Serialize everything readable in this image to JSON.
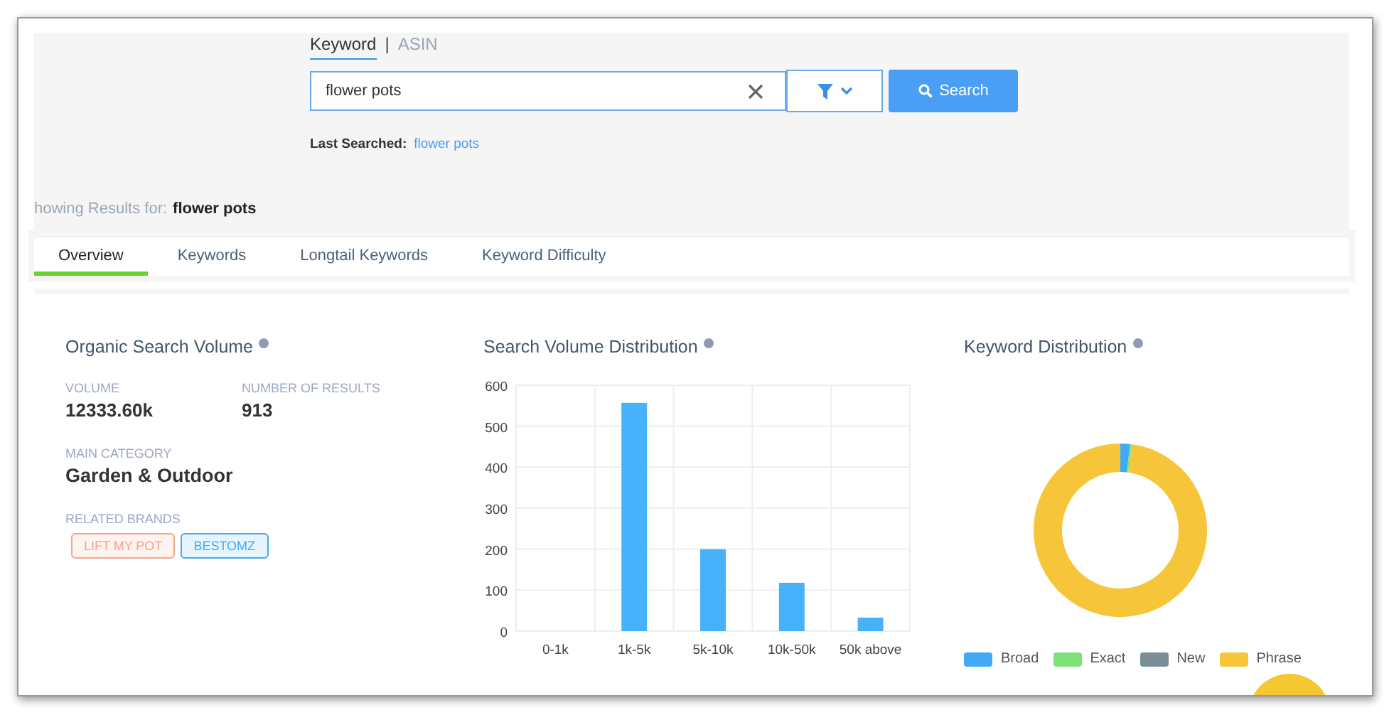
{
  "search_mode_separator": "|",
  "search_mode_tabs": [
    {
      "label": "Keyword",
      "selected": true
    },
    {
      "label": "ASIN",
      "selected": false
    }
  ],
  "search": {
    "value": "flower pots",
    "button": "Search"
  },
  "last_searched": {
    "label": "Last Searched:",
    "value": "flower pots"
  },
  "showing_results": {
    "label": "howing Results for:",
    "value": "flower pots"
  },
  "tabs": [
    {
      "label": "Overview",
      "selected": true
    },
    {
      "label": "Keywords",
      "selected": false
    },
    {
      "label": "Longtail Keywords",
      "selected": false
    },
    {
      "label": "Keyword Difficulty",
      "selected": false
    }
  ],
  "organic": {
    "title": "Organic Search Volume",
    "volume_label": "VOLUME",
    "volume": "12333.60k",
    "results_label": "NUMBER OF RESULTS",
    "results": "913",
    "category_label": "MAIN CATEGORY",
    "category": "Garden & Outdoor",
    "brands_label": "RELATED BRANDS",
    "brands": [
      {
        "name": "LIFT MY POT",
        "color": "#f4a58a"
      },
      {
        "name": "BESTOMZ",
        "color": "#42aaf5"
      }
    ]
  },
  "distribution": {
    "title": "Search Volume Distribution",
    "chart_data": {
      "type": "bar",
      "grid": true,
      "categories": [
        "0-1k",
        "1k-5k",
        "5k-10k",
        "10k-50k",
        "50k above"
      ],
      "values": [
        0,
        557,
        200,
        118,
        33
      ],
      "ylim": [
        0,
        600
      ],
      "yticks": [
        0,
        100,
        200,
        300,
        400,
        500,
        600
      ]
    }
  },
  "keyword_distribution": {
    "title": "Keyword Distribution",
    "legend": [
      {
        "name": "Broad",
        "color": "#42aaf5"
      },
      {
        "name": "Exact",
        "color": "#7de27a"
      },
      {
        "name": "New",
        "color": "#7a8d99"
      },
      {
        "name": "Phrase",
        "color": "#f7c53a"
      }
    ]
  }
}
